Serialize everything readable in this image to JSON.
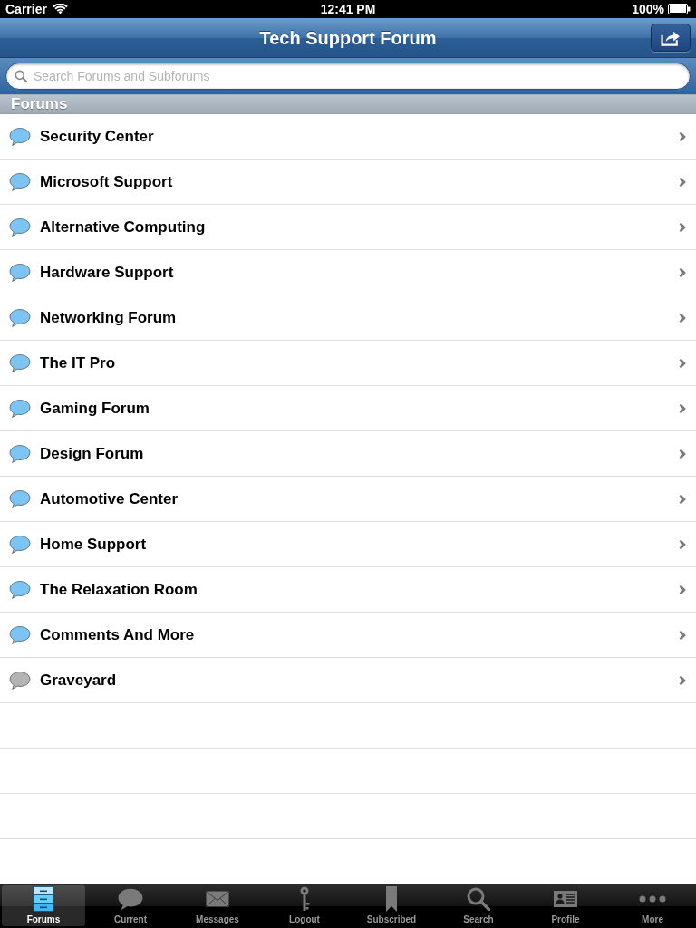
{
  "status_bar": {
    "carrier": "Carrier",
    "time": "12:41 PM",
    "battery": "100%"
  },
  "nav_bar": {
    "title": "Tech Support Forum"
  },
  "search": {
    "placeholder": "Search Forums and Subforums"
  },
  "section": {
    "title": "Forums"
  },
  "forums": [
    {
      "name": "Security Center",
      "color": "#7cc4f4"
    },
    {
      "name": "Microsoft Support",
      "color": "#7cc4f4"
    },
    {
      "name": "Alternative Computing",
      "color": "#7cc4f4"
    },
    {
      "name": "Hardware Support",
      "color": "#7cc4f4"
    },
    {
      "name": "Networking Forum",
      "color": "#7cc4f4"
    },
    {
      "name": "The IT Pro",
      "color": "#7cc4f4"
    },
    {
      "name": "Gaming Forum",
      "color": "#7cc4f4"
    },
    {
      "name": "Design Forum",
      "color": "#7cc4f4"
    },
    {
      "name": "Automotive Center",
      "color": "#7cc4f4"
    },
    {
      "name": "Home Support",
      "color": "#7cc4f4"
    },
    {
      "name": "The Relaxation Room",
      "color": "#7cc4f4"
    },
    {
      "name": "Comments And More",
      "color": "#7cc4f4"
    },
    {
      "name": "Graveyard",
      "color": "#b4b4b4"
    }
  ],
  "tab_bar": [
    {
      "label": "Forums",
      "selected": true
    },
    {
      "label": "Current",
      "selected": false
    },
    {
      "label": "Messages",
      "selected": false
    },
    {
      "label": "Logout",
      "selected": false
    },
    {
      "label": "Subscribed",
      "selected": false
    },
    {
      "label": "Search",
      "selected": false
    },
    {
      "label": "Profile",
      "selected": false
    },
    {
      "label": "More",
      "selected": false
    }
  ]
}
